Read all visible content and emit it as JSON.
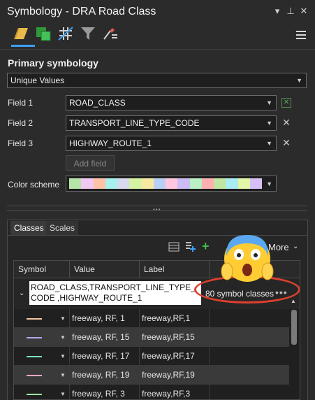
{
  "window": {
    "title": "Symbology - DRA Road Class",
    "controls": [
      "▾",
      "⊥",
      "✕"
    ]
  },
  "toolbar": {
    "icons": [
      "primary-symbology-icon",
      "vary-by-symbology-icon",
      "label-classes-icon",
      "filter-icon",
      "symbol-layer-drawing-icon"
    ],
    "menu_icon": "hamburger-menu-icon"
  },
  "primary": {
    "heading": "Primary symbology",
    "method": "Unique Values"
  },
  "fields": [
    {
      "label": "Field 1",
      "value": "ROAD_CLASS"
    },
    {
      "label": "Field 2",
      "value": "TRANSPORT_LINE_TYPE_CODE"
    },
    {
      "label": "Field 3",
      "value": "HIGHWAY_ROUTE_1"
    }
  ],
  "add_field": "Add field",
  "color_scheme": {
    "label": "Color scheme",
    "colors": [
      "#b7e4a8",
      "#f1c8f2",
      "#ffc2a8",
      "#a6f0ee",
      "#d8d8f0",
      "#d6f2a3",
      "#f7e9a2",
      "#b8d0f5",
      "#ffc6df",
      "#cbbcf5",
      "#b9f0c6",
      "#ffb0b0",
      "#c1e6a4",
      "#a9ecf2",
      "#e3f5a6",
      "#d7c0f7"
    ]
  },
  "tabs": [
    {
      "label": "Classes",
      "active": true
    },
    {
      "label": "Scales",
      "active": false
    }
  ],
  "classes_toolbar": {
    "more": "More"
  },
  "table": {
    "headers": [
      "Symbol",
      "Value",
      "Label"
    ],
    "group_heading": "ROAD_CLASS,TRANSPORT_LINE_TYPE_CODE ,HIGHWAY_ROUTE_1",
    "group_count": "80 symbol classes",
    "rows": [
      {
        "color": "#f2c7a6",
        "value": "freeway, RF, 1",
        "label": "freeway,RF,1"
      },
      {
        "color": "#b7a8f0",
        "value": "freeway, RF, 15",
        "label": "freeway,RF,15"
      },
      {
        "color": "#7fe0c8",
        "value": "freeway, RF, 17",
        "label": "freeway,RF,17"
      },
      {
        "color": "#f2a8c8",
        "value": "freeway, RF, 19",
        "label": "freeway,RF,19"
      },
      {
        "color": "#9fe6a2",
        "value": "freeway, RF, 3",
        "label": "freeway,RF,3"
      }
    ]
  }
}
